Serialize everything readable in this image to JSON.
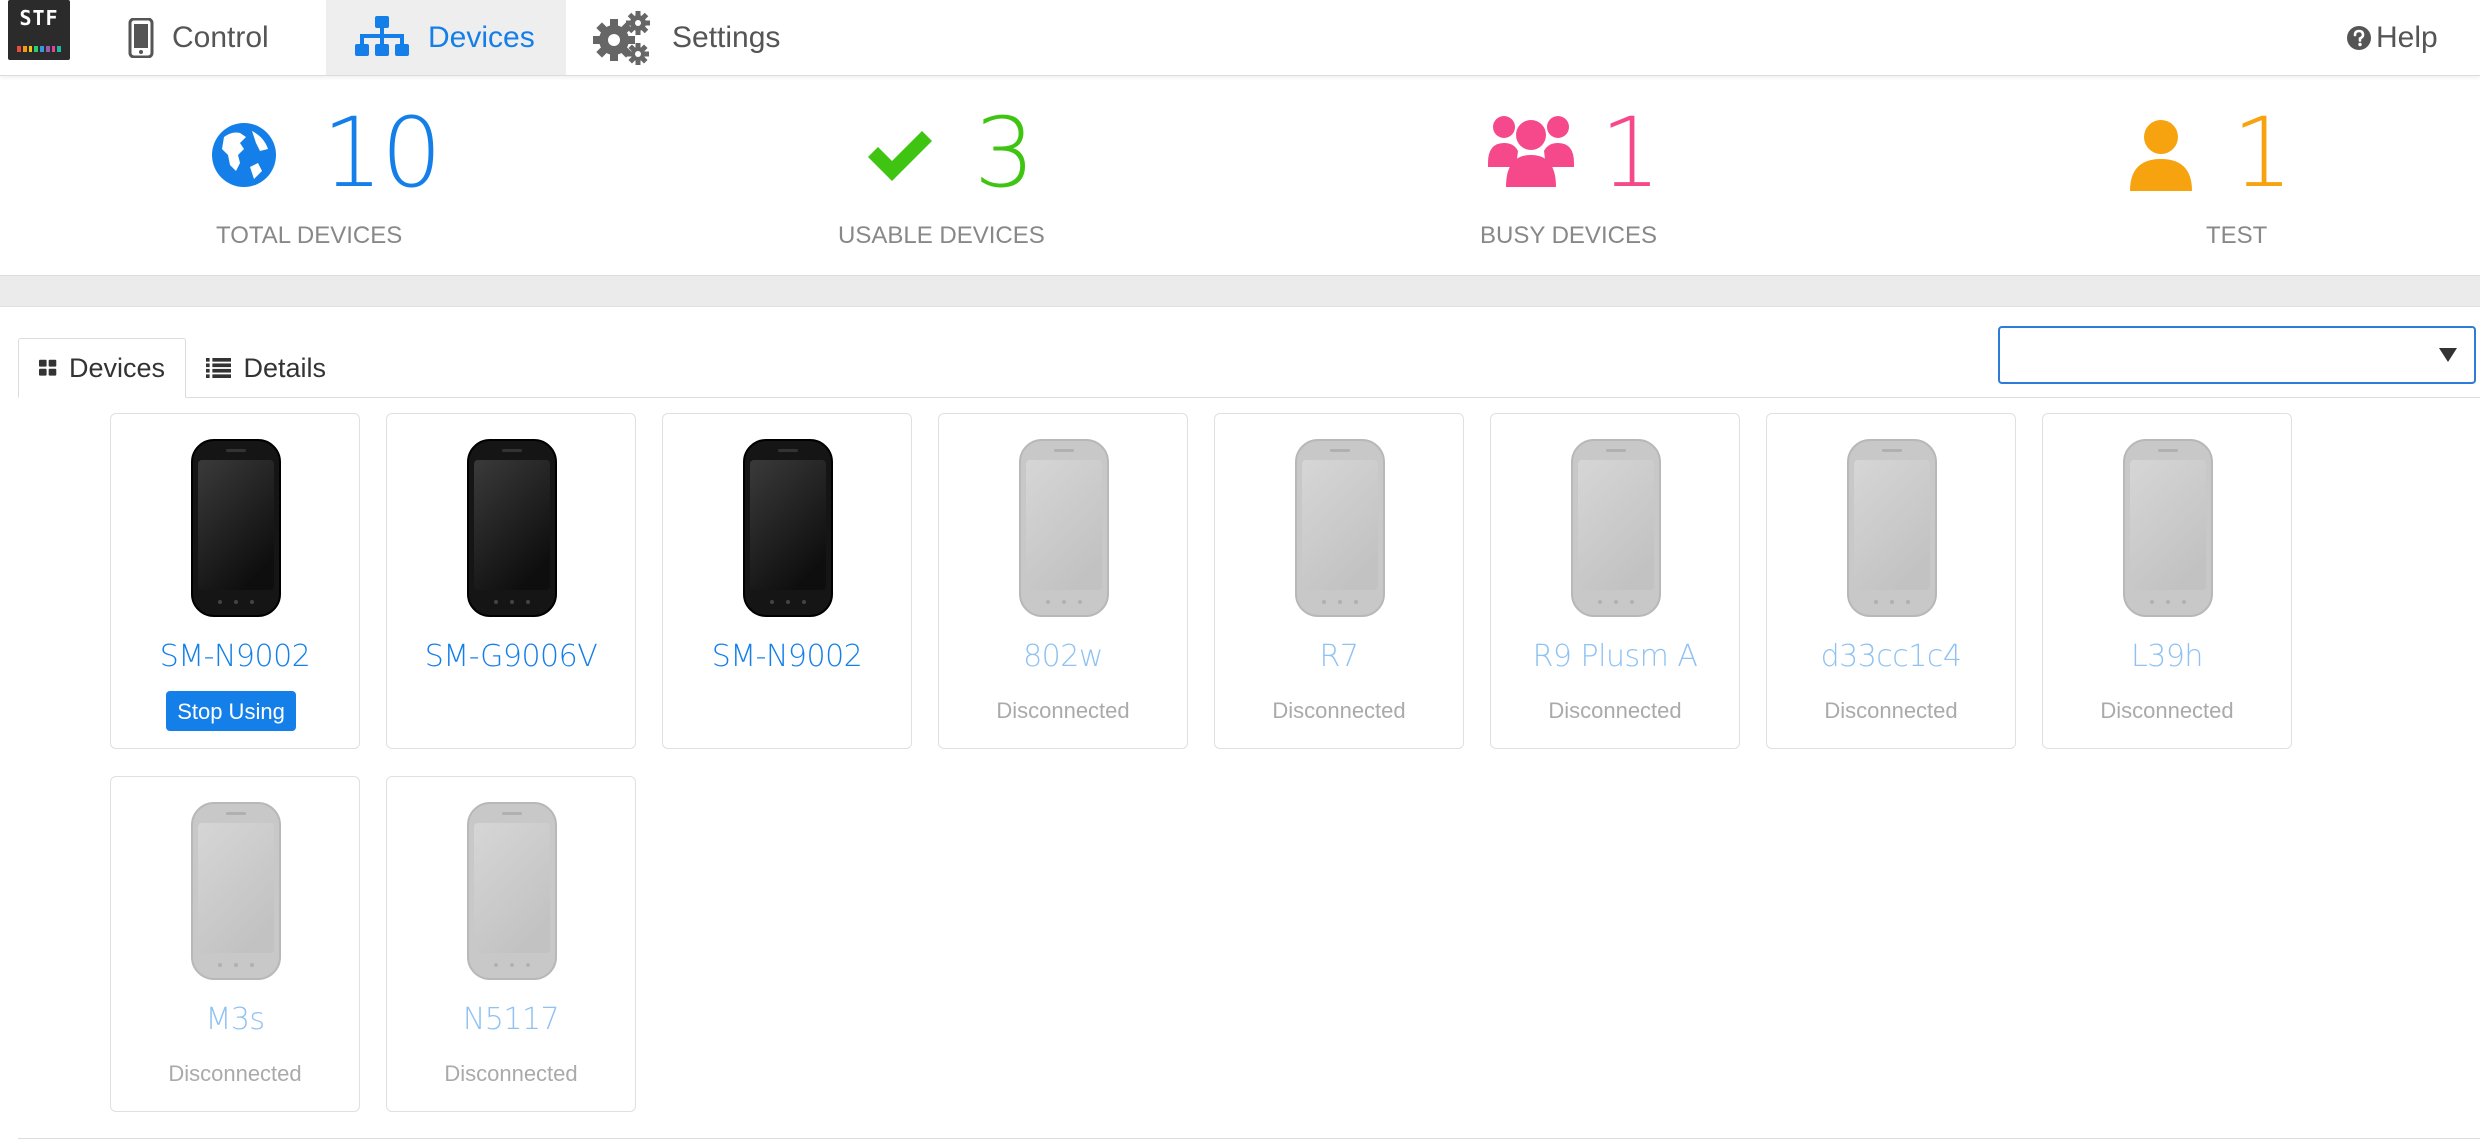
{
  "app": {
    "logo_text": "STF"
  },
  "nav": {
    "control_label": "Control",
    "devices_label": "Devices",
    "settings_label": "Settings",
    "help_label": "Help",
    "active": "devices"
  },
  "stats": [
    {
      "value": "10",
      "label": "TOTAL DEVICES",
      "icon": "globe-icon",
      "color": "#157fe9"
    },
    {
      "value": "3",
      "label": "USABLE DEVICES",
      "icon": "checkmark-icon",
      "color": "#3fc412"
    },
    {
      "value": "1",
      "label": "BUSY DEVICES",
      "icon": "users-icon",
      "color": "#f5498b"
    },
    {
      "value": "1",
      "label": "TEST",
      "icon": "user-icon",
      "color": "#f7a20f"
    }
  ],
  "tabs": {
    "devices_label": "Devices",
    "details_label": "Details",
    "active": "devices"
  },
  "filter": {
    "value": ""
  },
  "devices": [
    {
      "name": "SM-N9002",
      "state": "using",
      "action_label": "Stop Using"
    },
    {
      "name": "SM-G9006V",
      "state": "available",
      "status": ""
    },
    {
      "name": "SM-N9002",
      "state": "available",
      "status": ""
    },
    {
      "name": "802w",
      "state": "disconnected",
      "status": "Disconnected"
    },
    {
      "name": "R7",
      "state": "disconnected",
      "status": "Disconnected"
    },
    {
      "name": "R9 Plusm A",
      "state": "disconnected",
      "status": "Disconnected"
    },
    {
      "name": "d33cc1c4",
      "state": "disconnected",
      "status": "Disconnected"
    },
    {
      "name": "L39h",
      "state": "disconnected",
      "status": "Disconnected"
    },
    {
      "name": "M3s",
      "state": "disconnected",
      "status": "Disconnected"
    },
    {
      "name": "N5117",
      "state": "disconnected",
      "status": "Disconnected"
    }
  ]
}
